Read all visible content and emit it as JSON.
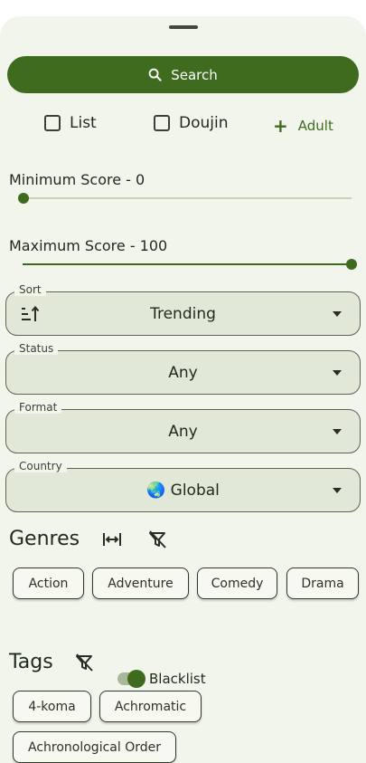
{
  "search": {
    "label": "Search",
    "icon": "search-icon"
  },
  "checks": {
    "list": {
      "label": "List",
      "checked": false
    },
    "doujin": {
      "label": "Doujin",
      "checked": false
    },
    "adult": {
      "label": "Adult"
    }
  },
  "min_score": {
    "label": "Minimum Score - 0",
    "value": 0
  },
  "max_score": {
    "label": "Maximum Score - 100",
    "value": 100
  },
  "sort": {
    "legend": "Sort",
    "value": "Trending"
  },
  "status": {
    "legend": "Status",
    "value": "Any"
  },
  "format": {
    "legend": "Format",
    "value": "Any"
  },
  "country": {
    "legend": "Country",
    "value": "🌏 Global"
  },
  "genres": {
    "title": "Genres",
    "items": [
      "Action",
      "Adventure",
      "Comedy",
      "Drama"
    ]
  },
  "tags": {
    "title": "Tags",
    "blacklist_label": "Blacklist",
    "blacklist_on": true,
    "items": [
      "4-koma",
      "Achromatic",
      "Achronological Order"
    ]
  },
  "colors": {
    "accent": "#3f6b1f",
    "surface": "#f2f5ec",
    "field": "#e2e8d7"
  }
}
